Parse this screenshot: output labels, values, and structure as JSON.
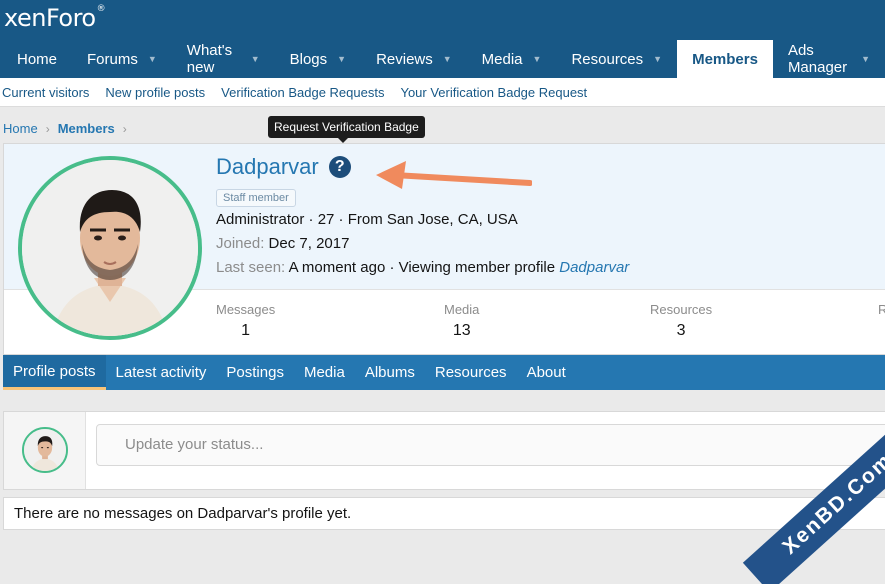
{
  "header": {
    "logo_text": "xenForo",
    "logo_mark": "®"
  },
  "nav": {
    "tabs": [
      {
        "label": "Home",
        "caret": false
      },
      {
        "label": "Forums",
        "caret": true
      },
      {
        "label": "What's new",
        "caret": true
      },
      {
        "label": "Blogs",
        "caret": true
      },
      {
        "label": "Reviews",
        "caret": true
      },
      {
        "label": "Media",
        "caret": true
      },
      {
        "label": "Resources",
        "caret": true
      },
      {
        "label": "Members",
        "caret": false,
        "selected": true
      },
      {
        "label": "Ads Manager",
        "caret": true
      }
    ]
  },
  "subnav": {
    "links": [
      "Current visitors",
      "New profile posts",
      "Verification Badge Requests",
      "Your Verification Badge Request"
    ]
  },
  "breadcrumb": {
    "home": "Home",
    "current": "Members"
  },
  "tooltip": {
    "text": "Request Verification Badge"
  },
  "profile": {
    "username": "Dadparvar",
    "verify_icon": "question-circle-icon",
    "badge": "Staff member",
    "role_line": "Administrator · 27 · From San Jose, CA, USA",
    "joined_label": "Joined:",
    "joined_value": "Dec 7, 2017",
    "last_seen_label": "Last seen:",
    "last_seen_value": "A moment ago · Viewing member profile",
    "last_seen_link": "Dadparvar",
    "ring_color": "#47bd8a"
  },
  "stats": [
    {
      "label": "Messages",
      "value": "1"
    },
    {
      "label": "Media",
      "value": "13"
    },
    {
      "label": "Resources",
      "value": "3"
    },
    {
      "label": "R",
      "value": ""
    }
  ],
  "profile_tabs": [
    "Profile posts",
    "Latest activity",
    "Postings",
    "Media",
    "Albums",
    "Resources",
    "About"
  ],
  "status": {
    "placeholder": "Update your status..."
  },
  "empty_message": "There are no messages on Dadparvar's profile yet.",
  "watermark": "XenBD.Com",
  "colors": {
    "brand": "#185886",
    "link": "#2577b1",
    "accent": "#47bd8a",
    "arrow": "#f08a5d"
  }
}
